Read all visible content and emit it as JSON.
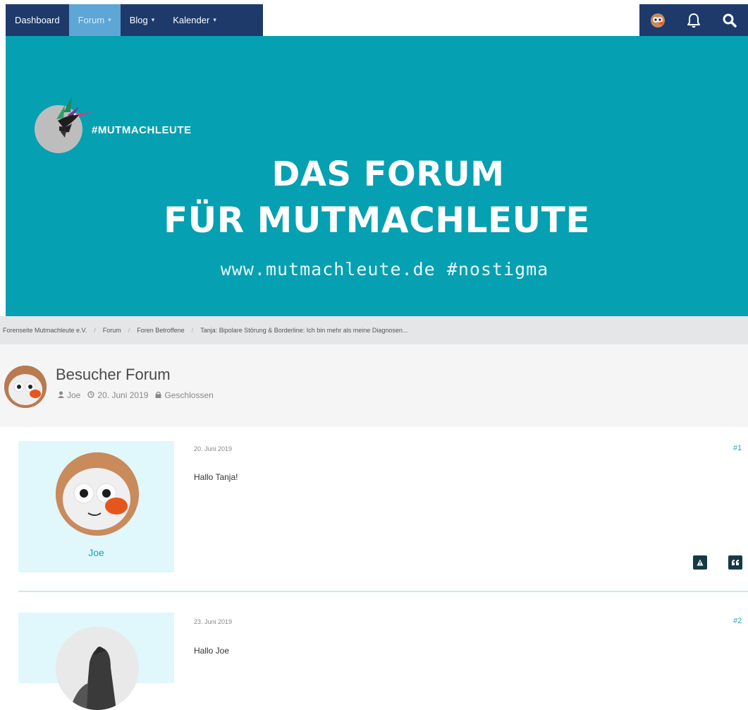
{
  "nav": {
    "items": [
      {
        "label": "Dashboard",
        "caret": ""
      },
      {
        "label": "Forum",
        "caret": "⌄"
      },
      {
        "label": "Blog",
        "caret": "⌄"
      },
      {
        "label": "Kalender",
        "caret": "⌄"
      }
    ],
    "icons": [
      "user-avatar-icon",
      "bell-icon",
      "search-icon"
    ]
  },
  "banner": {
    "logo_text": "#MUTMACHLEUTE",
    "title_line1": "DAS FORUM",
    "title_line2": "FÜR MUTMACHLEUTE",
    "url_line": "www.mutmachleute.de #nostigma"
  },
  "breadcrumb": [
    "Forenseite Mutmachleute e.V.",
    "Forum",
    "Foren Betroffene",
    "Tanja: Bipolare Störung & Borderline: Ich bin mehr als meine Diagnosen..."
  ],
  "thread": {
    "title": "Besucher Forum",
    "author": "Joe",
    "date": "20. Juni 2019",
    "status": "Geschlossen"
  },
  "posts": [
    {
      "username": "Joe",
      "date": "20. Juni 2019",
      "body": "Hallo Tanja!",
      "number": "#1"
    },
    {
      "username": "",
      "date": "23. Juni 2019",
      "body": "Hallo Joe",
      "number": "#2"
    }
  ],
  "colors": {
    "nav": "#1d3a6b",
    "nav_active": "#5ea6d6",
    "banner": "#05a0b2",
    "accent": "#1aa4bb",
    "sidebar": "#e0f7fc"
  }
}
